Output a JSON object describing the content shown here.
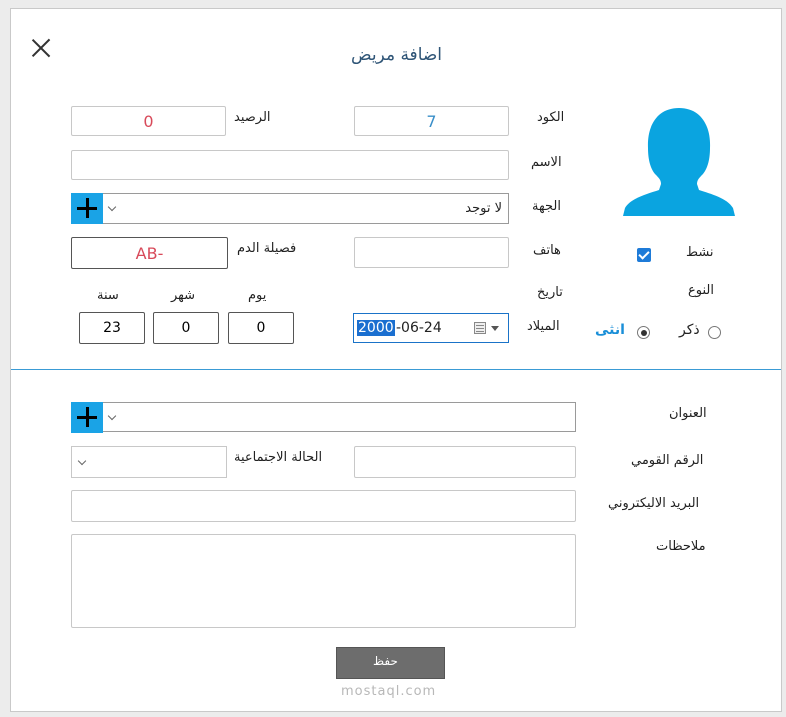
{
  "dialog": {
    "title": "اضافة مريض"
  },
  "form": {
    "code": {
      "label": "الكود",
      "value": "7"
    },
    "balance": {
      "label": "الرصيد",
      "value": "0"
    },
    "name": {
      "label": "الاسم",
      "value": ""
    },
    "entity": {
      "label": "الجهة",
      "value": "لا توجد"
    },
    "phone": {
      "label": "هاتف",
      "value": ""
    },
    "blood_type": {
      "label": "فصيلة الدم",
      "value": "AB-"
    },
    "active": {
      "label": "نشط",
      "checked": true
    },
    "gender": {
      "label": "النوع",
      "male": "ذكر",
      "female": "انثى",
      "selected": "female"
    },
    "birth_date": {
      "label_line1": "تاريخ",
      "label_line2": "الميلاد",
      "selected_part": "2000",
      "rest": "-06-24"
    },
    "age": {
      "years_label": "سنة",
      "years": "23",
      "months_label": "شهر",
      "months": "0",
      "days_label": "يوم",
      "days": "0"
    },
    "address": {
      "label": "العنوان",
      "value": ""
    },
    "national_id": {
      "label": "الرقم القومي",
      "value": ""
    },
    "marital_status": {
      "label": "الحالة الاجتماعية",
      "value": ""
    },
    "email": {
      "label": "البريد الاليكتروني",
      "value": ""
    },
    "notes": {
      "label": "ملاحظات",
      "value": ""
    }
  },
  "actions": {
    "save": "حفظ"
  },
  "watermark": "mostaql.com",
  "colors": {
    "accent": "#1aa3e6",
    "code_value": "#3a8fc9",
    "balance_value": "#d84a5a",
    "divider": "#3a9bd5",
    "save_button": "#6d6d6d",
    "avatar": "#0aa4e0"
  },
  "icons": {
    "close": "close-icon",
    "avatar": "user-silhouette-icon",
    "add": "plus-icon",
    "dropdown": "chevron-down-icon",
    "calendar": "calendar-icon"
  }
}
